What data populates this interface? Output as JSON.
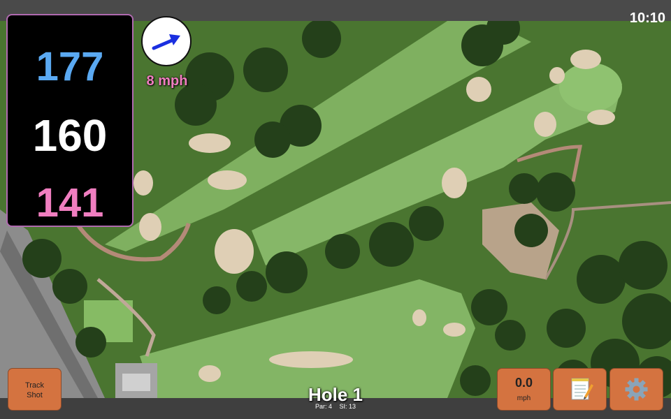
{
  "status": {
    "time": "10:10"
  },
  "yardages": {
    "back": "177",
    "middle": "160",
    "front": "141"
  },
  "wind": {
    "speed_label": "8 mph",
    "icon": "wind-direction-arrow-icon"
  },
  "hole": {
    "title": "Hole 1",
    "par": "Par: 4",
    "stroke_index": "SI: 13"
  },
  "buttons": {
    "track_shot_line1": "Track",
    "track_shot_line2": "Shot",
    "speed_value": "0.0",
    "speed_unit": "mph",
    "notes_icon": "notepad-icon",
    "settings_icon": "gear-icon"
  },
  "colors": {
    "back_yardage": "#5aa9f2",
    "middle_yardage": "#ffffff",
    "front_yardage": "#f07ec0",
    "button_accent": "#d47340",
    "wind_arrow": "#1a2fe0"
  }
}
